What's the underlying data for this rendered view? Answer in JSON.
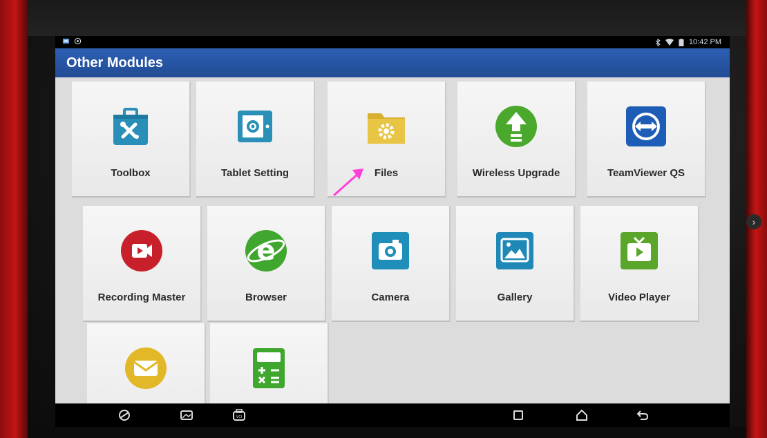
{
  "status_bar": {
    "time": "10:42 PM",
    "icons_left": [
      "app-notification-icon",
      "cast-icon"
    ],
    "icons_right": [
      "bluetooth-icon",
      "wifi-icon",
      "battery-icon"
    ]
  },
  "header": {
    "title": "Other Modules",
    "background": "#2a58a8"
  },
  "modules": [
    {
      "label": "Toolbox",
      "icon": "toolbox-icon",
      "color": "#2a8fb8"
    },
    {
      "label": "Tablet Setting",
      "icon": "tablet-settings-icon",
      "color": "#2a90b8"
    },
    {
      "label": "Files",
      "icon": "folder-gear-icon",
      "color": "#e3c13a"
    },
    {
      "label": "Wireless Upgrade",
      "icon": "upgrade-arrow-icon",
      "color": "#4aa82c"
    },
    {
      "label": "TeamViewer QS",
      "icon": "teamviewer-icon",
      "color": "#1e5db6"
    },
    {
      "label": "Recording Master",
      "icon": "record-video-icon",
      "color": "#c8202a"
    },
    {
      "label": "Browser",
      "icon": "browser-e-icon",
      "color": "#3fa72e"
    },
    {
      "label": "Camera",
      "icon": "camera-icon",
      "color": "#1f8fb9"
    },
    {
      "label": "Gallery",
      "icon": "gallery-icon",
      "color": "#2088b6"
    },
    {
      "label": "Video Player",
      "icon": "tv-play-icon",
      "color": "#5aa62a"
    },
    {
      "label": "",
      "icon": "email-icon",
      "color": "#e3b828"
    },
    {
      "label": "",
      "icon": "calculator-icon",
      "color": "#3fa72e"
    }
  ],
  "navigation_bar": {
    "buttons": [
      "browser-nav-icon",
      "gallery-nav-icon",
      "vci-icon",
      "recent-apps-icon",
      "home-icon",
      "back-icon"
    ]
  },
  "colors": {
    "accent_pink_arrow": "#ff3fd8",
    "case_red": "#c41414"
  }
}
